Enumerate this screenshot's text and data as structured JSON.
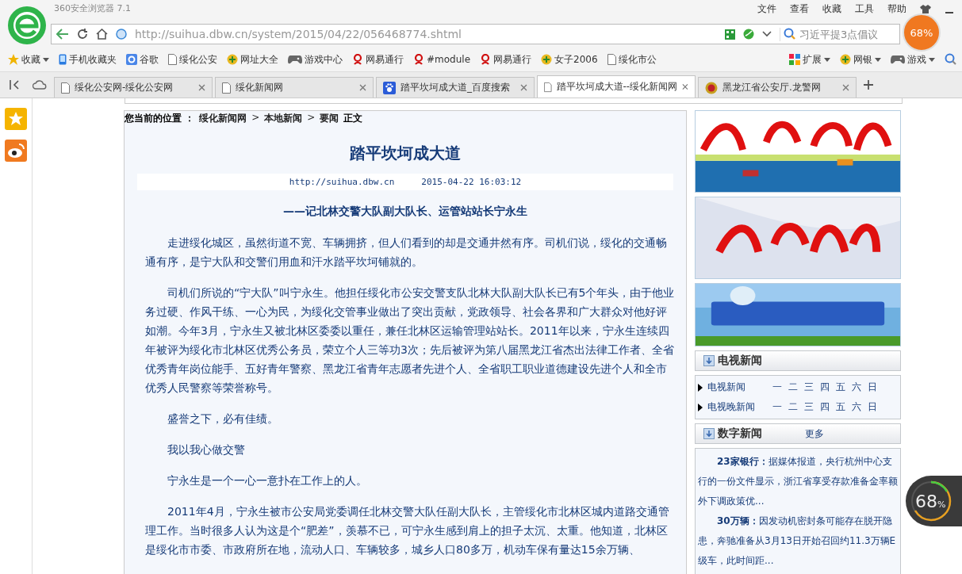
{
  "browser": {
    "title": "360安全浏览器 7.1",
    "menu": [
      "文件",
      "查看",
      "收藏",
      "工具",
      "帮助"
    ],
    "url": "http://suihua.dbw.cn/system/2015/04/22/056468774.shtml",
    "search_placeholder": "习近平提3点倡议",
    "memory_badge": "68%"
  },
  "bookmarks": {
    "favorites": "收藏",
    "items": [
      {
        "label": "手机收藏夹",
        "kind": "phone"
      },
      {
        "label": "谷歌",
        "kind": "square"
      },
      {
        "label": "绥化公安",
        "kind": "page"
      },
      {
        "label": "网址大全",
        "kind": "globe"
      },
      {
        "label": "游戏中心",
        "kind": "pad"
      },
      {
        "label": "网易通行",
        "kind": "red"
      },
      {
        "label": "#module",
        "kind": "red"
      },
      {
        "label": "网易通行",
        "kind": "red"
      },
      {
        "label": "女子2006",
        "kind": "globe"
      },
      {
        "label": "绥化市公",
        "kind": "page"
      }
    ],
    "tools": [
      {
        "label": "扩展",
        "kind": "grid"
      },
      {
        "label": "网银",
        "kind": "globe"
      },
      {
        "label": "游戏",
        "kind": "pad"
      }
    ]
  },
  "tabs": [
    {
      "label": "绥化公安网-绥化公安网",
      "kind": "page",
      "selected": false
    },
    {
      "label": "绥化新闻网",
      "kind": "page",
      "selected": false
    },
    {
      "label": "踏平坎坷成大道_百度搜索",
      "kind": "paw",
      "selected": false
    },
    {
      "label": "踏平坎坷成大道--绥化新闻网",
      "kind": "page",
      "selected": true
    },
    {
      "label": "黑龙江省公安厅.龙警网",
      "kind": "badge",
      "selected": false
    }
  ],
  "breadcrumb": [
    {
      "text": "您当前的位置 ：",
      "kind": "label"
    },
    {
      "text": "绥化新闻网",
      "kind": "link"
    },
    {
      "text": ">",
      "kind": "sep"
    },
    {
      "text": "本地新闻",
      "kind": "link"
    },
    {
      "text": ">",
      "kind": "sep"
    },
    {
      "text": "要闻",
      "kind": "link"
    },
    {
      "text": "正文",
      "kind": "label"
    }
  ],
  "article": {
    "title": "踏平坎坷成大道",
    "source": "http://suihua.dbw.cn",
    "date": "2015-04-22 16:03:12",
    "subtitle": "——记北林交警大队副大队长、运管站站长宁永生",
    "paragraphs": [
      "走进绥化城区，虽然街道不宽、车辆拥挤，但人们看到的却是交通井然有序。司机们说，绥化的交通畅通有序，是宁大队和交警们用血和汗水踏平坎坷铺就的。",
      "司机们所说的“宁大队”叫宁永生。他担任绥化市公安交警支队北林大队副大队长已有5个年头，由于他业务过硬、作风干练、一心为民，为绥化交管事业做出了突出贡献，党政领导、社会各界和广大群众对他好评如潮。今年3月，宁永生又被北林区委委以重任，兼任北林区运输管理站站长。2011年以来，宁永生连续四年被评为绥化市北林区优秀公务员，荣立个人三等功3次；先后被评为第八届黑龙江省杰出法律工作者、全省优秀青年岗位能手、五好青年警察、黑龙江省青年志愿者先进个人、全省职工职业道德建设先进个人和全市优秀人民警察等荣誉称号。",
      "盛誉之下，必有佳绩。",
      "我以我心做交警",
      "宁永生是一个一心一意扑在工作上的人。",
      "2011年4月，宁永生被市公安局党委调任北林交警大队任副大队长，主管绥化市北林区城内道路交通管理工作。当时很多人认为这是个“肥差”，羡慕不已，可宁永生感到肩上的担子太沉、太重。他知道，北林区是绥化市市委、市政府所在地，流动人口、车辆较多，城乡人口80多万，机动车保有量达15余万辆、"
    ]
  },
  "tv_news": {
    "heading": "电视新闻",
    "rows": [
      {
        "label": "电视新闻",
        "days": [
          "一",
          "二",
          "三",
          "四",
          "五",
          "六",
          "日"
        ]
      },
      {
        "label": "电视晚新闻",
        "days": [
          "一",
          "二",
          "三",
          "四",
          "五",
          "六",
          "日"
        ]
      }
    ]
  },
  "digital_news": {
    "heading": "数字新闻",
    "more": "更多",
    "items": [
      {
        "lead": "23家银行：",
        "text": "据媒体报道，央行杭州中心支行的一份文件显示，浙江省享受存款准备金率额外下调政策优..."
      },
      {
        "lead": "30万辆：",
        "text": "因发动机密封条可能存在脱开隐患，奔驰准备从3月13日开始召回约11.3万辆E级车，此时间距..."
      }
    ]
  },
  "memory_widget": {
    "value": "68",
    "unit": "%"
  }
}
